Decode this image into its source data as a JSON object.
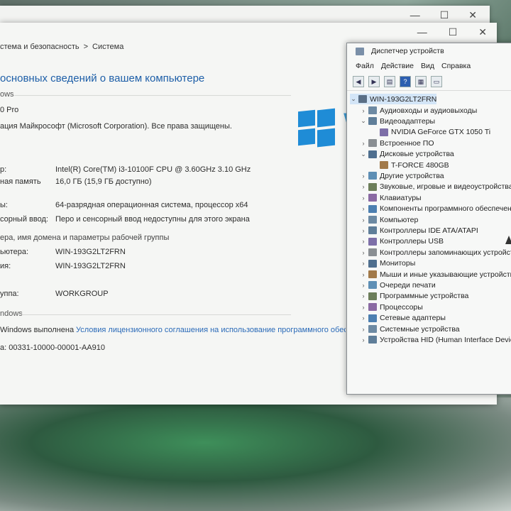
{
  "background_window": {
    "controls": [
      "—",
      "☐",
      "✕"
    ]
  },
  "system_window": {
    "controls": [
      "—",
      "☐",
      "✕"
    ],
    "breadcrumb": [
      "стема и безопасность",
      ">",
      "Система"
    ],
    "heading": "основных сведений о вашем компьютере",
    "edition": {
      "section": "ows",
      "version": "0 Pro",
      "copyright": "ация Майкрософт (Microsoft Corporation). Все права защищены."
    },
    "system": {
      "rows": [
        {
          "label": "р:",
          "value": "Intel(R) Core(TM) i3-10100F CPU @ 3.60GHz   3.10 GHz"
        },
        {
          "label": "ная память",
          "value": "16,0 ГБ (15,9 ГБ доступно)"
        },
        {
          "label": "ы:",
          "value": "64-разрядная операционная система, процессор x64"
        },
        {
          "label": "сорный ввод:",
          "value": "Перо и сенсорный ввод недоступны для этого экрана"
        }
      ]
    },
    "computer": {
      "section": "ера, имя домена и параметры рабочей группы",
      "rows": [
        {
          "label": "ьютера:",
          "value": "WIN-193G2LT2FRN"
        },
        {
          "label": "ия:",
          "value": "WIN-193G2LT2FRN"
        },
        {
          "label": "уппа:",
          "value": "WORKGROUP"
        }
      ]
    },
    "activation": {
      "section": "ndows",
      "status": "Windows выполнена",
      "link": "Условия лицензионного соглашения на использование программного обеспеч",
      "product_id": "а: 00331-10000-00001-AA910"
    },
    "logo_text": "W"
  },
  "device_manager": {
    "title": "Диспетчер устройств",
    "menu": [
      "Файл",
      "Действие",
      "Вид",
      "Справка"
    ],
    "root": "WIN-193G2LT2FRN",
    "nodes": [
      {
        "label": "Аудиовходы и аудиовыходы",
        "expanded": false,
        "indent": 1
      },
      {
        "label": "Видеоадаптеры",
        "expanded": true,
        "indent": 1
      },
      {
        "label": "NVIDIA GeForce GTX 1050 Ti",
        "expanded": null,
        "indent": 2
      },
      {
        "label": "Встроенное ПО",
        "expanded": false,
        "indent": 1
      },
      {
        "label": "Дисковые устройства",
        "expanded": true,
        "indent": 1
      },
      {
        "label": "T-FORCE 480GB",
        "expanded": null,
        "indent": 2
      },
      {
        "label": "Другие устройства",
        "expanded": false,
        "indent": 1
      },
      {
        "label": "Звуковые, игровые и видеоустройства",
        "expanded": false,
        "indent": 1
      },
      {
        "label": "Клавиатуры",
        "expanded": false,
        "indent": 1
      },
      {
        "label": "Компоненты программного обеспечения",
        "expanded": false,
        "indent": 1
      },
      {
        "label": "Компьютер",
        "expanded": false,
        "indent": 1
      },
      {
        "label": "Контроллеры IDE ATA/ATAPI",
        "expanded": false,
        "indent": 1
      },
      {
        "label": "Контроллеры USB",
        "expanded": false,
        "indent": 1
      },
      {
        "label": "Контроллеры запоминающих устройств",
        "expanded": false,
        "indent": 1
      },
      {
        "label": "Мониторы",
        "expanded": false,
        "indent": 1
      },
      {
        "label": "Мыши и иные указывающие устройства",
        "expanded": false,
        "indent": 1
      },
      {
        "label": "Очереди печати",
        "expanded": false,
        "indent": 1
      },
      {
        "label": "Программные устройства",
        "expanded": false,
        "indent": 1
      },
      {
        "label": "Процессоры",
        "expanded": false,
        "indent": 1
      },
      {
        "label": "Сетевые адаптеры",
        "expanded": false,
        "indent": 1
      },
      {
        "label": "Системные устройства",
        "expanded": false,
        "indent": 1
      },
      {
        "label": "Устройства HID (Human Interface Devices)",
        "expanded": false,
        "indent": 1
      }
    ],
    "toolbar_icons": [
      "back-icon",
      "forward-icon",
      "properties-icon",
      "help-icon",
      "view-icon",
      "monitor-icon"
    ]
  },
  "colors": {
    "accent": "#1e5fa8",
    "link": "#2a6ab8",
    "windows_logo": "#1f8cd6"
  }
}
